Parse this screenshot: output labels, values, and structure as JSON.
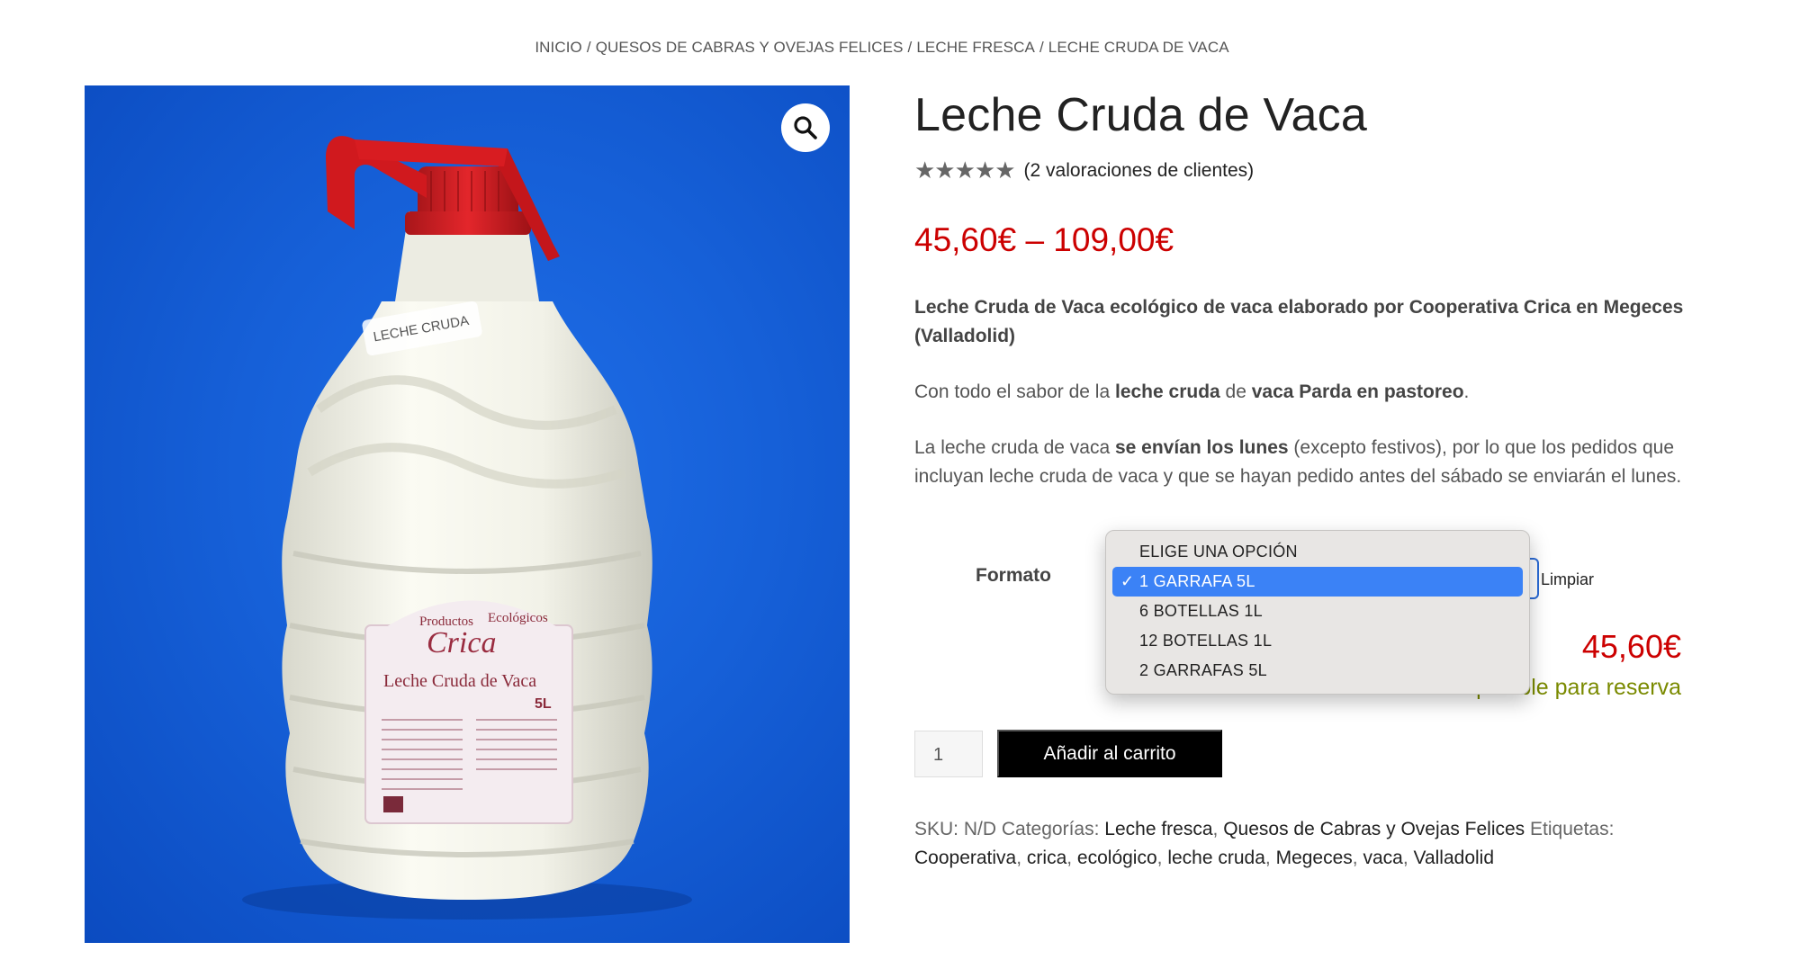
{
  "breadcrumb": [
    "INICIO",
    "QUESOS DE CABRAS Y OVEJAS FELICES",
    "LECHE FRESCA",
    "LECHE CRUDA DE VACA"
  ],
  "product": {
    "title": "Leche Cruda de Vaca",
    "stars": "★★★★★",
    "rating_value": 5,
    "reviews_text": "(2 valoraciones de clientes)",
    "price_range": "45,60€ – 109,00€",
    "image_alt": "Garrafa Leche Cruda de Vaca 5L Crica"
  },
  "image_label": {
    "cap_sticker": "LECHE CRUDA",
    "brand_top": "Productos",
    "brand_right": "Ecológicos",
    "brand_name": "Crica",
    "label_title": "Leche Cruda de Vaca",
    "size": "5L"
  },
  "description": {
    "p1": "Leche Cruda de Vaca ecológico de vaca elaborado por Cooperativa Crica en Megeces (Valladolid)",
    "p2_a": "Con todo el sabor de la ",
    "p2_b": "leche cruda",
    "p2_c": " de ",
    "p2_d": "vaca Parda en pastoreo",
    "p2_e": ".",
    "p3_a": "La leche cruda de vaca ",
    "p3_b": "se envían los lunes",
    "p3_c": " (excepto festivos), por lo que los pedidos que incluyan leche cruda de vaca y que se hayan pedido antes del sábado se enviarán el lunes."
  },
  "variation": {
    "label": "Formato",
    "options": [
      "ELIGE UNA OPCIÓN",
      "1 GARRAFA 5L",
      "6 BOTELLAS 1L",
      "12 BOTELLAS 1L",
      "2 GARRAFAS 5L"
    ],
    "selected": "1 GARRAFA 5L",
    "check": "✓",
    "clear": "Limpiar",
    "price": "45,60€",
    "availability": "Disponible para reserva"
  },
  "cart": {
    "quantity": "1",
    "add_to_cart": "Añadir al carrito"
  },
  "meta": {
    "sku_label": "SKU:",
    "sku_value": "N/D",
    "categories_label": "Categorías:",
    "categories": [
      "Leche fresca",
      "Quesos de Cabras y Ovejas Felices"
    ],
    "tags_label": "Etiquetas:",
    "tags": [
      "Cooperativa",
      "crica",
      "ecológico",
      "leche cruda",
      "Megeces",
      "vaca",
      "Valladolid"
    ]
  },
  "colors": {
    "price": "#cc0000",
    "availability": "#7a8a00",
    "button": "#000000",
    "selected_option": "#3b82f6",
    "image_background": "#1660d8"
  },
  "icons": {
    "zoom": "magnifier-icon",
    "rating": "star-icon",
    "check": "checkmark-icon"
  }
}
